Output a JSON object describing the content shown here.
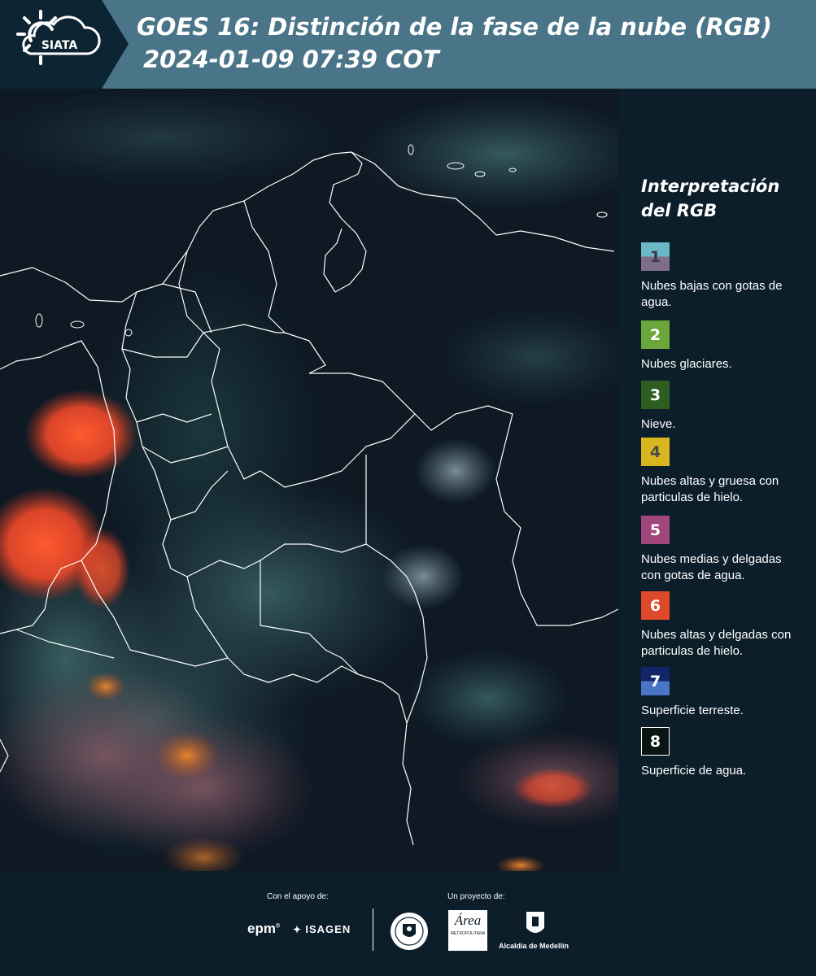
{
  "header": {
    "logo_text": "SIATA",
    "title": "GOES 16: Distinción de la fase de la nube (RGB)",
    "subtitle": "2024-01-09 07:39 COT",
    "background_color": "#4a7588"
  },
  "legend": {
    "title_line1": "Interpretación",
    "title_line2": "del RGB",
    "items": [
      {
        "number": "1",
        "label": "Nubes bajas con gotas de agua.",
        "color_top": "#6ab7c6",
        "color_bottom": "#7e6e8c"
      },
      {
        "number": "2",
        "label": "Nubes glaciares.",
        "color_top": "#6aa63a",
        "color_bottom": "#6aa63a"
      },
      {
        "number": "3",
        "label": "Nieve.",
        "color_top": "#2d5e1f",
        "color_bottom": "#2d5e1f"
      },
      {
        "number": "4",
        "label": "Nubes altas y gruesa con particulas de hielo.",
        "color_top": "#d9b51f",
        "color_bottom": "#d9b51f"
      },
      {
        "number": "5",
        "label": "Nubes medias y delgadas con gotas de agua.",
        "color_top": "#a1467a",
        "color_bottom": "#a1467a"
      },
      {
        "number": "6",
        "label": "Nubes altas y delgadas con particulas de hielo.",
        "color_top": "#e0482a",
        "color_bottom": "#e0482a"
      },
      {
        "number": "7",
        "label": "Superficie terreste.",
        "color_top": "#12256a",
        "color_bottom": "#4a74c4"
      },
      {
        "number": "8",
        "label": "Superficie de agua.",
        "color_top": "#0a1410",
        "color_bottom": "#0a1410"
      }
    ]
  },
  "footer": {
    "support_label": "Con el apoyo de:",
    "project_label": "Un proyecto de:",
    "sponsor_epm": "epm",
    "sponsor_isagen": "ISAGEN",
    "area_logo_text": "Área",
    "area_logo_sub": "METROPOLITANA",
    "alcaldia": "Alcaldía de Medellín"
  }
}
